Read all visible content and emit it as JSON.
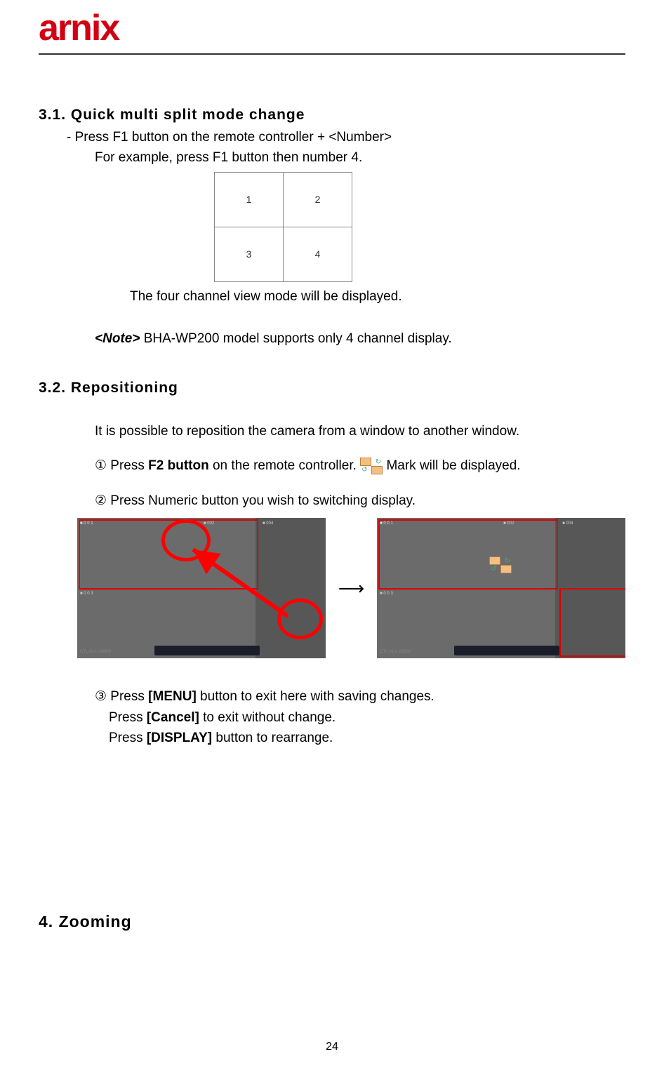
{
  "logo": {
    "text": "arnix"
  },
  "sec31": {
    "heading": "3.1.  Quick  multi  split  mode  change",
    "line1": "- Press F1 button on the remote controller + <Number>",
    "line2": "For example, press F1 button then number 4.",
    "cells": {
      "c1": "1",
      "c2": "2",
      "c3": "3",
      "c4": "4"
    },
    "caption": "The four channel view mode will be displayed.",
    "note_label": "<Note>",
    "note_text": " BHA-WP200 model supports only 4 channel display."
  },
  "sec32": {
    "heading": "3.2.  Repositioning",
    "intro": "It is possible to reposition the camera from a window to another window.",
    "step1_pre": "① Press ",
    "step1_bold": "F2 button",
    "step1_mid": " on the remote controller. ",
    "step1_post": " Mark will be displayed.",
    "step2": "② Press Numeric button you wish to switching display.",
    "step3_pre": "③ Press ",
    "step3_bold": "[MENU]",
    "step3_post": " button to exit here with saving changes.",
    "step4_pre": "Press ",
    "step4_bold": "[Cancel]",
    "step4_post": " to exit without change.",
    "step5_pre": "Press ",
    "step5_bold": "[DISPLAY]",
    "step5_post": " button to rearrange."
  },
  "sec4": {
    "heading": "4. Zooming"
  },
  "page_number": "24"
}
